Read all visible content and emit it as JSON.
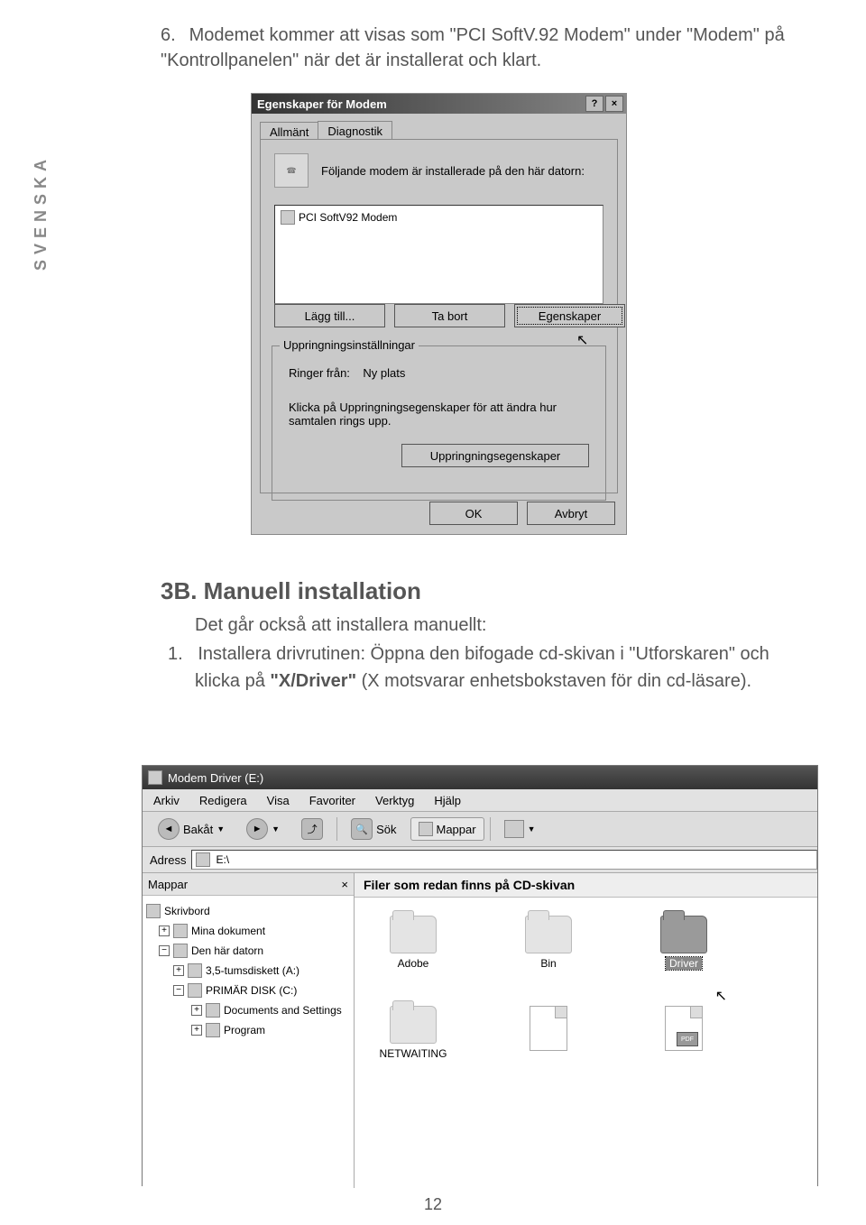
{
  "sideLabel": "SVENSKA",
  "introNumber": "6.",
  "introText": "Modemet kommer att visas som \"PCI SoftV.92 Modem\" under \"Modem\" på \"Kontrollpanelen\" när det är installerat och klart.",
  "dialog": {
    "title": "Egenskaper för Modem",
    "helpBtn": "?",
    "closeBtn": "×",
    "tabs": {
      "general": "Allmänt",
      "diag": "Diagnostik"
    },
    "descr": "Följande modem är installerade på den här datorn:",
    "item": "PCI SoftV92 Modem",
    "addBtn": "Lägg till...",
    "removeBtn": "Ta bort",
    "propsBtn": "Egenskaper",
    "groupTitle": "Uppringningsinställningar",
    "callingFrom": "Ringer från:",
    "callingValue": "Ny plats",
    "helpText": "Klicka på Uppringningsegenskaper för att ändra hur samtalen rings upp.",
    "dialBtn": "Uppringningsegenskaper",
    "ok": "OK",
    "cancel": "Avbryt"
  },
  "section": {
    "title": "3B. Manuell installation",
    "line1": "Det går också att installera manuellt:",
    "step1num": "1.",
    "step1": "Installera drivrutinen: Öppna den bifogade cd-skivan i \"Utforskaren\" och klicka på ",
    "step1bold": "\"X/Driver\"",
    "step1cont": " (X motsvarar enhetsbokstaven för din cd-läsare)."
  },
  "explorer": {
    "title": "Modem Driver (E:)",
    "menus": [
      "Arkiv",
      "Redigera",
      "Visa",
      "Favoriter",
      "Verktyg",
      "Hjälp"
    ],
    "back": "Bakåt",
    "search": "Sök",
    "folders": "Mappar",
    "addressLabel": "Adress",
    "addressValue": "E:\\",
    "leftTitle": "Mappar",
    "closeX": "×",
    "tree": {
      "desktop": "Skrivbord",
      "mydocs": "Mina dokument",
      "mycomp": "Den här datorn",
      "floppy": "3,5-tumsdiskett (A:)",
      "primdisk": "PRIMÄR DISK (C:)",
      "docs": "Documents and Settings",
      "program": "Program"
    },
    "rightTitle": "Filer som redan finns på CD-skivan",
    "items": {
      "adobe": "Adobe",
      "bin": "Bin",
      "driver": "Driver",
      "netwaiting": "NETWAITING"
    }
  },
  "pageNumber": "12"
}
